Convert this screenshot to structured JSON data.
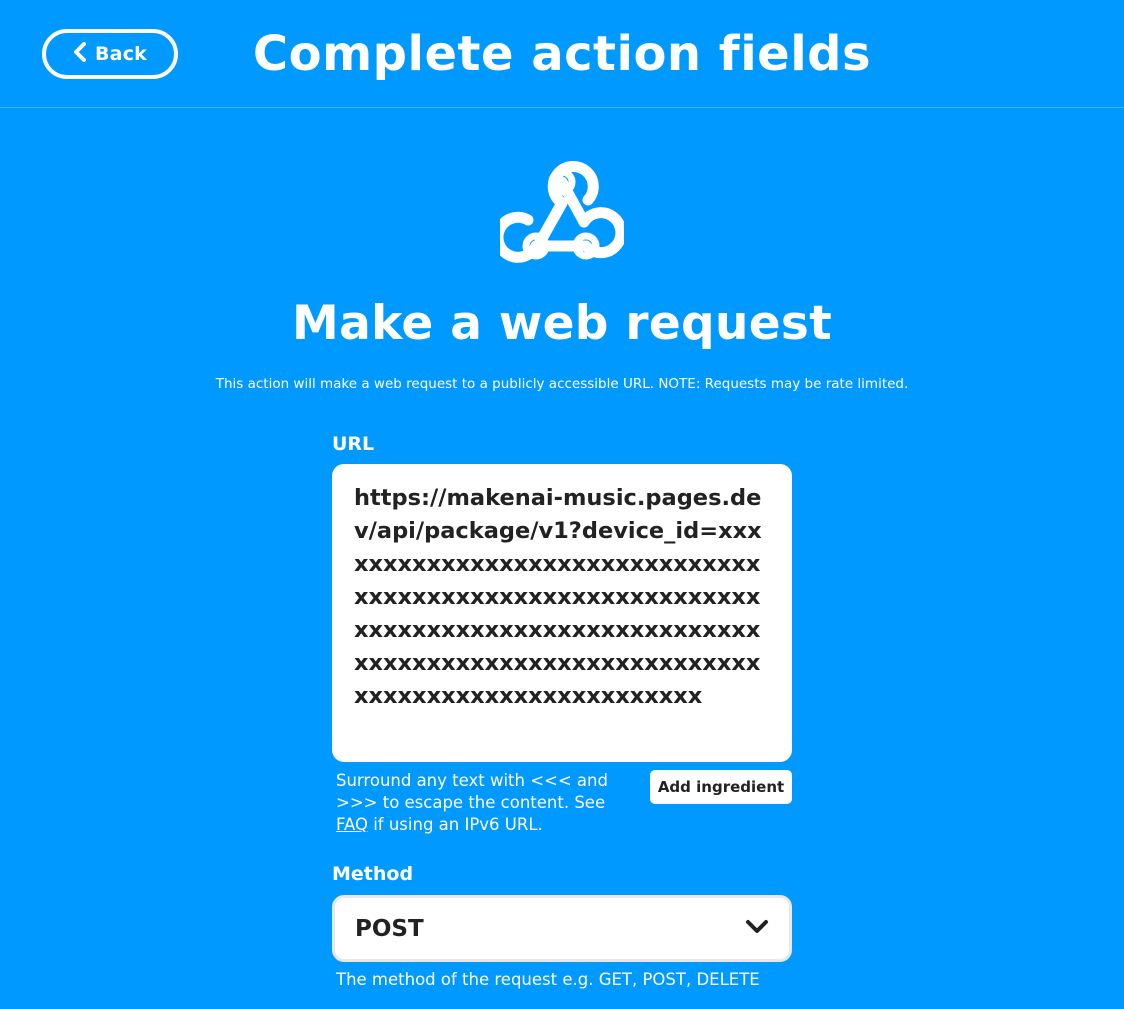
{
  "header": {
    "back_label": "Back",
    "title": "Complete action fields"
  },
  "service": {
    "icon": "webhook-icon",
    "title": "Make a web request",
    "description": "This action will make a web request to a publicly accessible URL. NOTE: Requests may be rate limited."
  },
  "url_field": {
    "label": "URL",
    "value": "https://makenai-music.pages.dev/api/package/v1?device_id=xxxxxxxxxxxxxxxxxxxxxxxxxxxxxxxxxxxxxxxxxxxxxxxxxxxxxxxxxxxxxxxxxxxxxxxxxxxxxxxxxxxxxxxxxxxxxxxxxxxxxxxxxxxxxxxxxxxxxxxxxxxxxxxxxxxxxxxxxxx",
    "hint_before_link": "Surround any text with <<< and >>> to escape the content. See ",
    "hint_link": "FAQ",
    "hint_after_link": " if using an IPv6 URL.",
    "add_ingredient_label": "Add ingredient"
  },
  "method_field": {
    "label": "Method",
    "value": "POST",
    "hint": "The method of the request e.g. GET, POST, DELETE"
  },
  "colors": {
    "background": "#0099ff",
    "text": "#ffffff",
    "field_background": "#ffffff",
    "field_text": "#222222"
  }
}
